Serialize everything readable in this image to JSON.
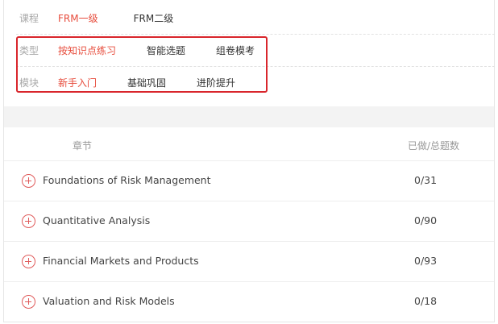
{
  "filters": {
    "course": {
      "label": "课程",
      "options": [
        "FRM一级",
        "FRM二级"
      ],
      "active": 0
    },
    "type": {
      "label": "类型",
      "options": [
        "按知识点练习",
        "智能选题",
        "组卷模考"
      ],
      "active": 0
    },
    "module": {
      "label": "模块",
      "options": [
        "新手入门",
        "基础巩固",
        "进阶提升"
      ],
      "active": 0
    }
  },
  "table": {
    "headers": {
      "chapter": "章节",
      "progress": "已做/总题数"
    },
    "rows": [
      {
        "title": "Foundations of Risk Management",
        "count": "0/31"
      },
      {
        "title": "Quantitative Analysis",
        "count": "0/90"
      },
      {
        "title": "Financial Markets and Products",
        "count": "0/93"
      },
      {
        "title": "Valuation and Risk Models",
        "count": "0/18"
      }
    ]
  },
  "colors": {
    "active": "#e74c3c",
    "highlight_border": "#d9262c",
    "expand_icon": "#e05a5a"
  },
  "icons": {
    "expand": "plus-circle-icon"
  }
}
